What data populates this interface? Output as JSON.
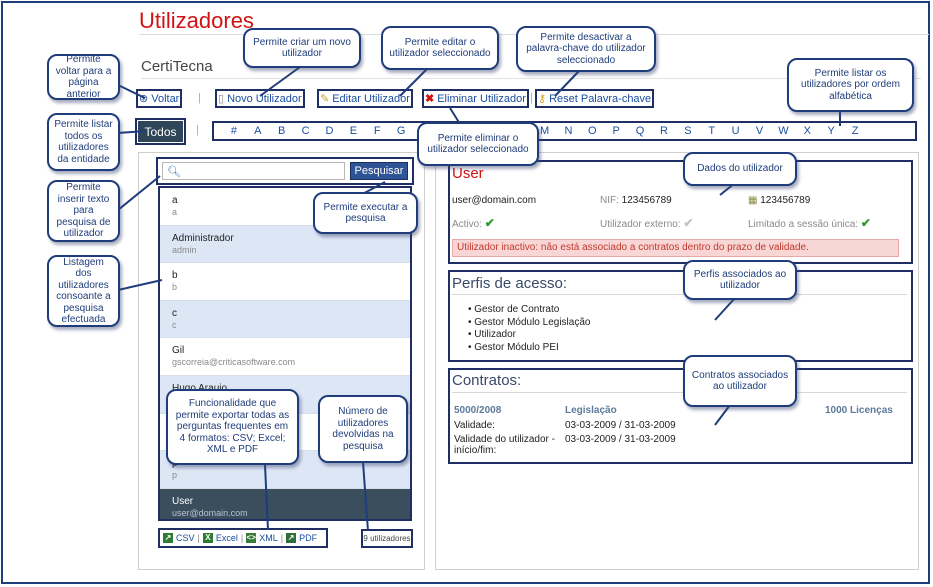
{
  "page": {
    "title": "Utilizadores",
    "company": "CertiTecna"
  },
  "toolbar": {
    "back": "Voltar",
    "new_user": "Novo Utilizador",
    "edit_user": "Editar Utilizador",
    "delete_user": "Eliminar Utilizador",
    "reset_password": "Reset Palavra-chave"
  },
  "filter": {
    "all": "Todos",
    "letters": [
      "#",
      "A",
      "B",
      "C",
      "D",
      "E",
      "F",
      "G",
      "H",
      "I",
      "J",
      "K",
      "L",
      "M",
      "N",
      "O",
      "P",
      "Q",
      "R",
      "S",
      "T",
      "U",
      "V",
      "W",
      "X",
      "Y",
      "Z"
    ]
  },
  "search": {
    "button": "Pesquisar",
    "value": ""
  },
  "users": [
    {
      "name": "a",
      "sub": "a"
    },
    {
      "name": "Administrador",
      "sub": "admin"
    },
    {
      "name": "b",
      "sub": "b"
    },
    {
      "name": "c",
      "sub": "c"
    },
    {
      "name": "Gil",
      "sub": "gscorreia@criticasoftware.com"
    },
    {
      "name": "Hugo Araujo",
      "sub": ""
    },
    {
      "name": "",
      "sub": ""
    },
    {
      "name": "p",
      "sub": "p"
    },
    {
      "name": "User",
      "sub": "user@domain.com"
    }
  ],
  "export": {
    "csv": "CSV",
    "excel": "Excel",
    "xml": "XML",
    "pdf": "PDF",
    "count": "9 utilizadores"
  },
  "user_detail": {
    "name": "User",
    "email": "user@domain.com",
    "nif_label": "NIF:",
    "nif": "123456789",
    "phone": "123456789",
    "active_label": "Activo:",
    "external_label": "Utilizador externo:",
    "single_session_label": "Limitado a sessão única:",
    "warning": "Utilizador inactivo: não está associado a contratos dentro do prazo de validade."
  },
  "profiles": {
    "title": "Perfis de acesso:",
    "items": [
      "Gestor de Contrato",
      "Gestor Módulo Legislação",
      "Utilizador",
      "Gestor Módulo PEI"
    ]
  },
  "contracts": {
    "title": "Contratos:",
    "number": "5000/2008",
    "module": "Legislação",
    "licenses": "1000 Licenças",
    "validity_label": "Validade:",
    "validity": "03-03-2009 / 31-03-2009",
    "user_validity_label": "Validade do utilizador - início/fim:",
    "user_validity": "03-03-2009 / 31-03-2009"
  },
  "callouts": {
    "back": "Permite voltar para a página anterior",
    "new_user": "Permite criar um novo utilizador",
    "edit": "Permite editar o utilizador seleccionado",
    "deactivate": "Permite desactivar a palavra-chave do utilizador seleccionado",
    "alpha": "Permite listar os utilizadores por ordem alfabética",
    "all": "Permite listar todos os utilizadores da entidade",
    "delete": "Permite eliminar o utilizador seleccionado",
    "user_data": "Dados do utilizador",
    "search_text": "Permite inserir texto para pesquisa de utilizador",
    "search_exec": "Permite executar a pesquisa",
    "list": "Listagem dos utilizadores consoante a pesquisa efectuada",
    "profiles": "Perfis associados ao utilizador",
    "contracts": "Contratos associados ao utilizador",
    "export": "Funcionalidade que permite exportar todas as perguntas frequentes em 4 formatos: CSV; Excel; XML e PDF",
    "count": "Número de utilizadores devolvidas na pesquisa"
  }
}
